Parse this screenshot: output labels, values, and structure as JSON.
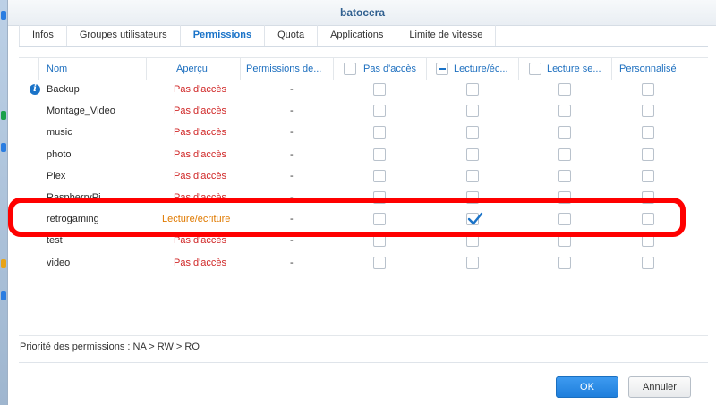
{
  "window": {
    "title": "batocera"
  },
  "tabs": [
    {
      "label": "Infos"
    },
    {
      "label": "Groupes utilisateurs"
    },
    {
      "label": "Permissions"
    },
    {
      "label": "Quota"
    },
    {
      "label": "Applications"
    },
    {
      "label": "Limite de vitesse"
    }
  ],
  "active_tab": "Permissions",
  "table": {
    "headers": {
      "nom": "Nom",
      "apercu": "Aperçu",
      "perm_de": "Permissions de...",
      "pas_acces": "Pas d'accès",
      "lecture_ecriture": "Lecture/éc...",
      "lecture_seule": "Lecture se...",
      "personnalise": "Personnalisé"
    },
    "rows": [
      {
        "nom": "Backup",
        "apercu": "Pas d'accès",
        "perm_de": "-",
        "read_write": false
      },
      {
        "nom": "Montage_Video",
        "apercu": "Pas d'accès",
        "perm_de": "-",
        "read_write": false
      },
      {
        "nom": "music",
        "apercu": "Pas d'accès",
        "perm_de": "-",
        "read_write": false
      },
      {
        "nom": "photo",
        "apercu": "Pas d'accès",
        "perm_de": "-",
        "read_write": false
      },
      {
        "nom": "Plex",
        "apercu": "Pas d'accès",
        "perm_de": "-",
        "read_write": false
      },
      {
        "nom": "RaspberryPi",
        "apercu": "Pas d'accès",
        "perm_de": "-",
        "read_write": false
      },
      {
        "nom": "retrogaming",
        "apercu": "Lecture/écriture",
        "perm_de": "-",
        "read_write": true
      },
      {
        "nom": "test",
        "apercu": "Pas d'accès",
        "perm_de": "-",
        "read_write": false
      },
      {
        "nom": "video",
        "apercu": "Pas d'accès",
        "perm_de": "-",
        "read_write": false
      }
    ]
  },
  "priority_text": "Priorité des permissions : NA > RW > RO",
  "buttons": {
    "ok": "OK",
    "cancel": "Annuler"
  },
  "colors": {
    "accent": "#1a73c8",
    "no_access": "#d02727",
    "read_write": "#e07a00",
    "highlight": "#ff0000"
  }
}
